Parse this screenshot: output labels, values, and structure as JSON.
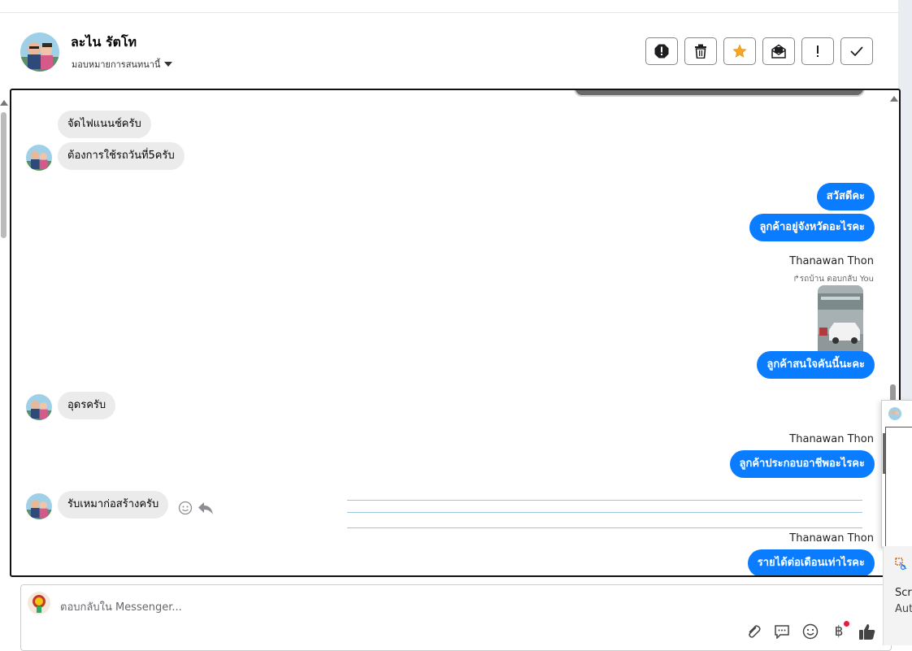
{
  "header": {
    "contact_name": "ละไน รัตโท",
    "assign_label": "มอบหมายการสนทนานี้",
    "toolbar_icons": [
      "alert-octagon-icon",
      "trash-icon",
      "star-icon",
      "mark-unread-icon",
      "important-icon",
      "check-icon"
    ]
  },
  "colors": {
    "outgoing_bubble": "#0a7cff",
    "incoming_bubble": "#ebebeb",
    "star": "#f5a623"
  },
  "messages": {
    "in_1": "จัดไฟแนนช์ครับ",
    "in_2": "ต้องการใช้รถวันที่5ครับ",
    "out_1": "สวัสดีคะ",
    "out_2": "ลูกค้าอยู่จังหวัดอะไรคะ",
    "sender_1": "Thanawan Thon",
    "reply_note": "รถบ้าน ตอบกลับ You",
    "out_3": "ลูกค้าสนใจคันนี้นะคะ",
    "in_3": "อุดรครับ",
    "sender_2": "Thanawan Thon",
    "out_4": "ลูกค้าประกอบอาชีพอะไรคะ",
    "in_4": "รับเหมาก่อสร้างครับ",
    "sender_3": "Thanawan Thon",
    "out_5": "รายได้ต่อเดือนเท่าไรคะ"
  },
  "composer": {
    "placeholder": "ตอบกลับใน Messenger...",
    "tools": [
      "attach-icon",
      "saved-reply-icon",
      "emoji-icon",
      "baht-payment-icon",
      "like-icon"
    ]
  },
  "side_panel": {
    "text_1": "Scre",
    "text_2": "Aut"
  }
}
